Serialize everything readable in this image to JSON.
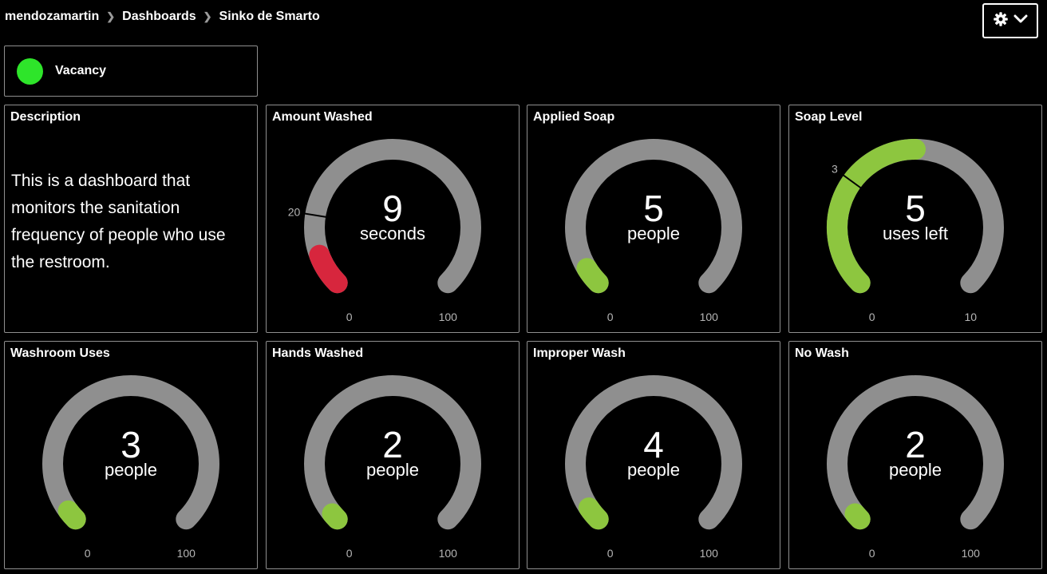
{
  "breadcrumb": {
    "items": [
      "mendozamartin",
      "Dashboards",
      "Sinko de Smarto"
    ]
  },
  "icons": {
    "settings": "gear-icon",
    "dropdown": "chevron-down-icon",
    "separator": "chevron-right-icon"
  },
  "colors": {
    "background": "#000000",
    "track": "#8f8f8f",
    "green": "#8dc63f",
    "red": "#d7263d",
    "vacancy": "#2ee52a"
  },
  "vacancy": {
    "label": "Vacancy",
    "status_color": "#2ee52a"
  },
  "description": {
    "title": "Description",
    "text": "This is a dashboard that monitors the sanitation frequency of people who use the restroom."
  },
  "gauges": [
    {
      "title": "Amount Washed",
      "value": "9",
      "unit": "seconds",
      "min": 0,
      "max": 100,
      "fill": 9,
      "color": "#d7263d",
      "threshold": 20,
      "threshold_label": "20"
    },
    {
      "title": "Applied Soap",
      "value": "5",
      "unit": "people",
      "min": 0,
      "max": 100,
      "fill": 5,
      "color": "#8dc63f"
    },
    {
      "title": "Soap Level",
      "value": "5",
      "unit": "uses left",
      "min": 0,
      "max": 10,
      "fill": 5,
      "color": "#8dc63f",
      "threshold": 3,
      "threshold_label": "3"
    },
    {
      "title": "Washroom Uses",
      "value": "3",
      "unit": "people",
      "min": 0,
      "max": 100,
      "fill": 3,
      "color": "#8dc63f"
    },
    {
      "title": "Hands Washed",
      "value": "2",
      "unit": "people",
      "min": 0,
      "max": 100,
      "fill": 2,
      "color": "#8dc63f"
    },
    {
      "title": "Improper Wash",
      "value": "4",
      "unit": "people",
      "min": 0,
      "max": 100,
      "fill": 4,
      "color": "#8dc63f"
    },
    {
      "title": "No Wash",
      "value": "2",
      "unit": "people",
      "min": 0,
      "max": 100,
      "fill": 2,
      "color": "#8dc63f"
    }
  ]
}
